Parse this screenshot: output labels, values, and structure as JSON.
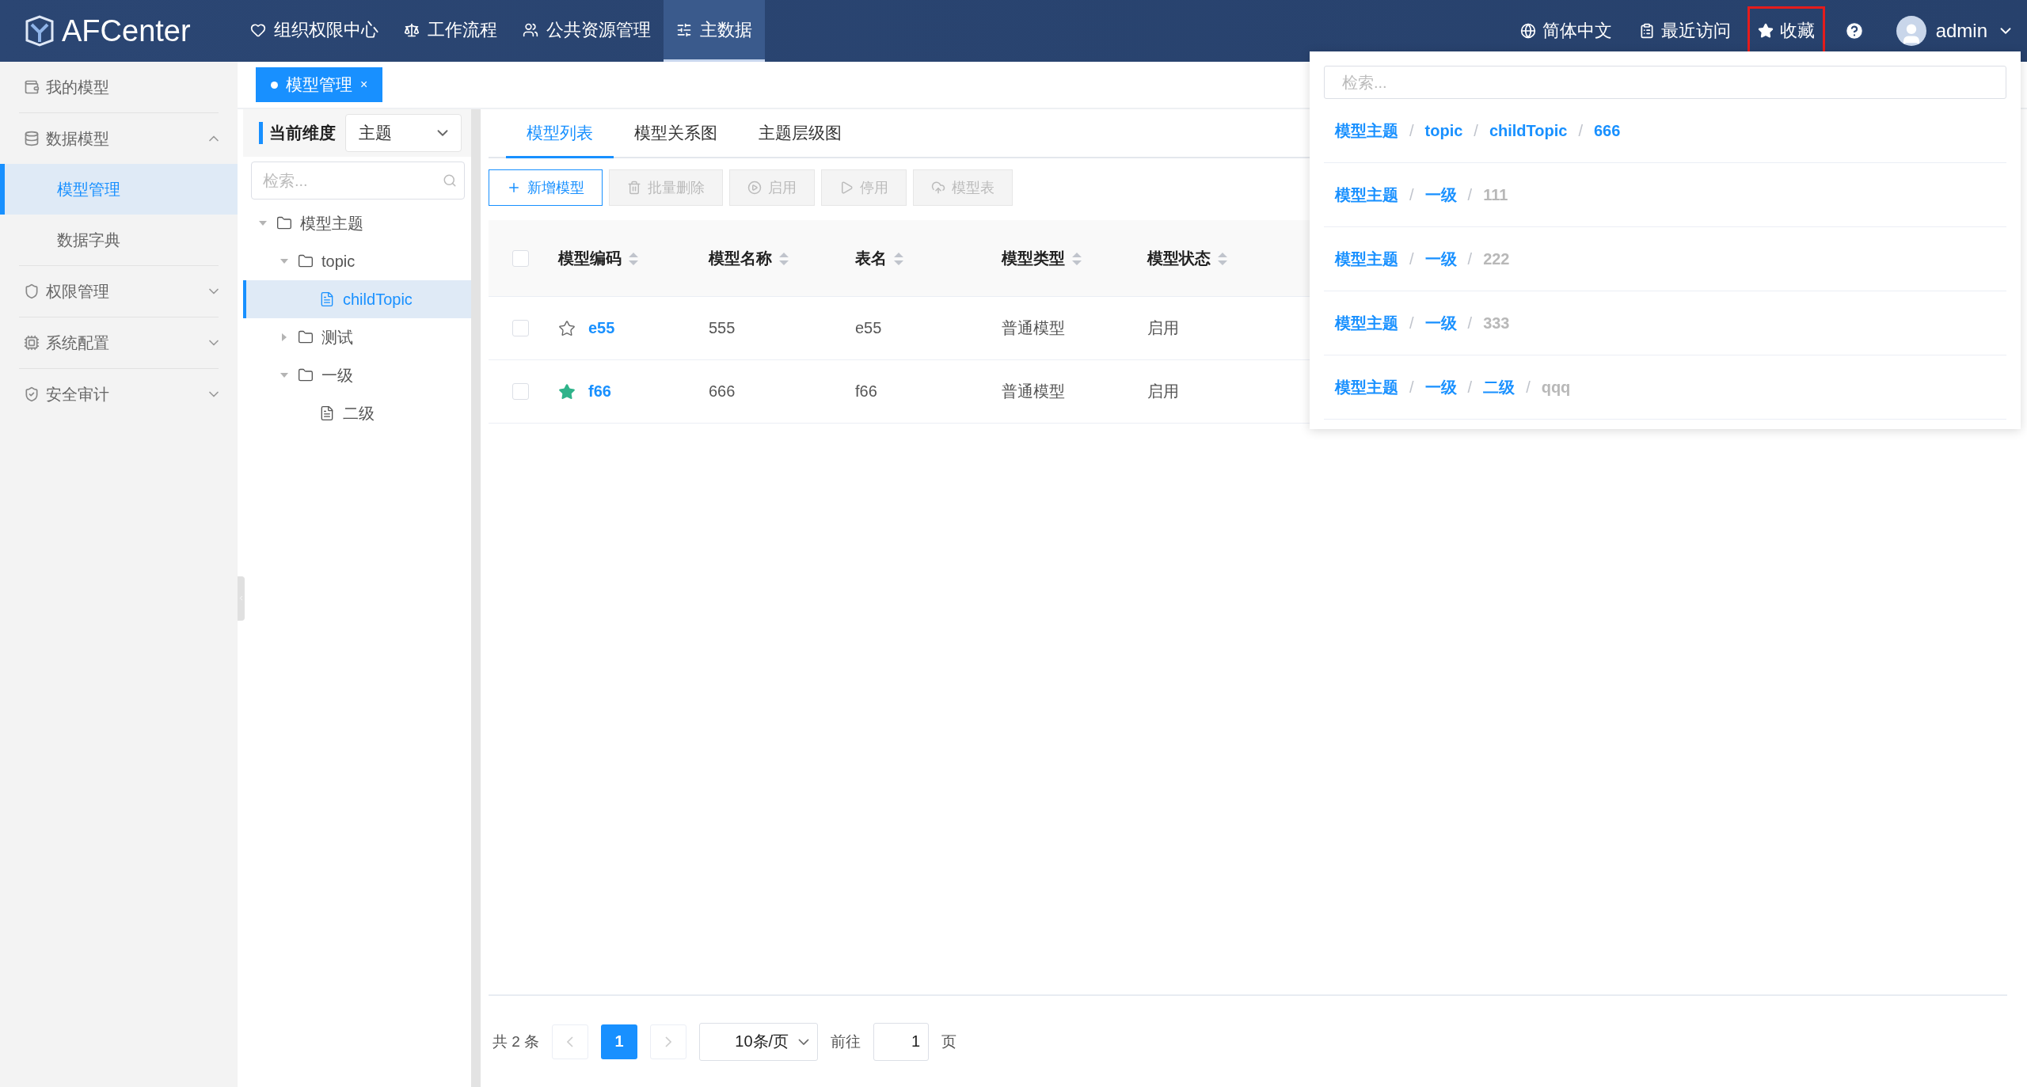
{
  "app": {
    "logo": "AFCenter"
  },
  "top_nav": [
    {
      "label": "组织权限中心",
      "selected": false
    },
    {
      "label": "工作流程",
      "selected": false
    },
    {
      "label": "公共资源管理",
      "selected": false
    },
    {
      "label": "主数据",
      "selected": true
    }
  ],
  "header_actions": [
    {
      "label": "简体中文",
      "selected": false
    },
    {
      "label": "最近访问",
      "selected": false
    },
    {
      "label": "收藏",
      "selected": true
    }
  ],
  "user": {
    "name": "admin"
  },
  "sidebar": {
    "items": [
      {
        "label": "我的模型",
        "kind": "link"
      },
      {
        "label": "数据模型",
        "kind": "group",
        "expanded": true,
        "children": [
          {
            "label": "模型管理",
            "selected": true
          },
          {
            "label": "数据字典",
            "selected": false
          }
        ]
      },
      {
        "label": "权限管理",
        "kind": "group",
        "expanded": false
      },
      {
        "label": "系统配置",
        "kind": "group",
        "expanded": false
      },
      {
        "label": "安全审计",
        "kind": "group",
        "expanded": false
      }
    ]
  },
  "open_tabs": [
    {
      "label": "模型管理",
      "selected": true,
      "close": "×"
    }
  ],
  "dimension": {
    "label": "当前维度",
    "value": "主题"
  },
  "tree_search": {
    "placeholder": "检索..."
  },
  "tree": [
    {
      "label": "模型主题",
      "kind": "folder",
      "expanded": true,
      "selected": false,
      "children": [
        {
          "label": "topic",
          "kind": "folder",
          "expanded": true,
          "selected": false,
          "children": [
            {
              "label": "childTopic",
              "kind": "file",
              "selected": true
            }
          ]
        },
        {
          "label": "测试",
          "kind": "folder",
          "expanded": false,
          "selected": false
        },
        {
          "label": "一级",
          "kind": "folder",
          "expanded": true,
          "selected": false,
          "children": [
            {
              "label": "二级",
              "kind": "file",
              "selected": false
            }
          ]
        }
      ]
    }
  ],
  "view_tabs": [
    {
      "label": "模型列表",
      "selected": true
    },
    {
      "label": "模型关系图",
      "selected": false
    },
    {
      "label": "主题层级图",
      "selected": false
    }
  ],
  "toolbar": [
    {
      "label": "新增模型",
      "kind": "add",
      "disabled": false
    },
    {
      "label": "批量删除",
      "kind": "delete",
      "disabled": true
    },
    {
      "label": "启用",
      "kind": "enable",
      "disabled": true
    },
    {
      "label": "停用",
      "kind": "disable",
      "disabled": true
    },
    {
      "label": "模型表",
      "kind": "upload",
      "disabled": true
    }
  ],
  "table": {
    "all_checked": false,
    "columns": [
      {
        "label": "模型编码"
      },
      {
        "label": "模型名称"
      },
      {
        "label": "表名"
      },
      {
        "label": "模型类型"
      },
      {
        "label": "模型状态"
      }
    ],
    "rows": [
      {
        "checked": false,
        "starred": false,
        "cells": [
          "e55",
          "555",
          "e55",
          "普通模型",
          "启用"
        ]
      },
      {
        "checked": false,
        "starred": true,
        "cells": [
          "f66",
          "666",
          "f66",
          "普通模型",
          "启用"
        ]
      }
    ]
  },
  "pagination": {
    "total": "共 2 条",
    "pages": [
      {
        "label": "1",
        "selected": true
      }
    ],
    "page_size": "10条/页",
    "goto_label": "前往",
    "goto_value": "1",
    "goto_suffix": "页"
  },
  "favorites_popup": {
    "search": {
      "placeholder": "检索..."
    },
    "separator": "/",
    "items": [
      {
        "path": [
          {
            "text": "模型主题",
            "link": true
          },
          {
            "text": "topic",
            "link": true
          },
          {
            "text": "childTopic",
            "link": true
          },
          {
            "text": "666",
            "link": true
          }
        ]
      },
      {
        "path": [
          {
            "text": "模型主题",
            "link": true
          },
          {
            "text": "一级",
            "link": true
          },
          {
            "text": "111",
            "link": false
          }
        ]
      },
      {
        "path": [
          {
            "text": "模型主题",
            "link": true
          },
          {
            "text": "一级",
            "link": true
          },
          {
            "text": "222",
            "link": false
          }
        ]
      },
      {
        "path": [
          {
            "text": "模型主题",
            "link": true
          },
          {
            "text": "一级",
            "link": true
          },
          {
            "text": "333",
            "link": false
          }
        ]
      },
      {
        "path": [
          {
            "text": "模型主题",
            "link": true
          },
          {
            "text": "一级",
            "link": true
          },
          {
            "text": "二级",
            "link": true
          },
          {
            "text": "qqq",
            "link": false
          }
        ]
      }
    ]
  }
}
